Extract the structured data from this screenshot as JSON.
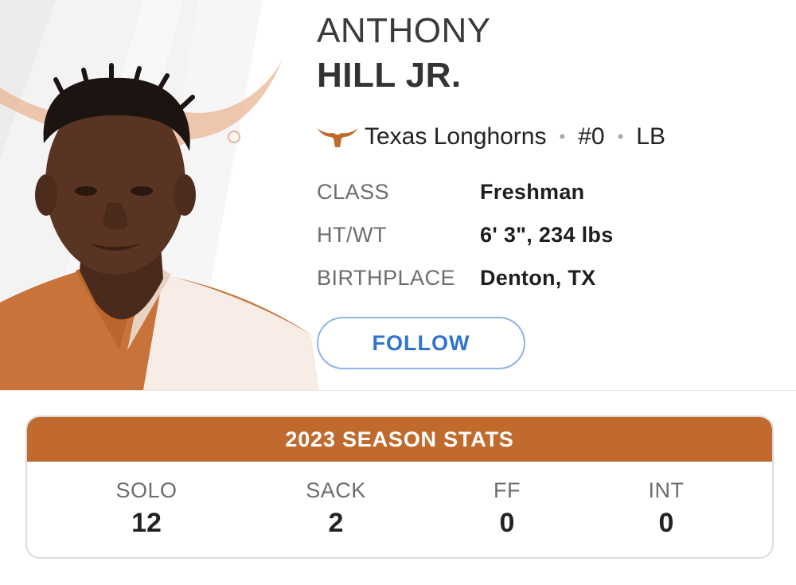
{
  "player": {
    "first_name": "ANTHONY",
    "last_name": "HILL JR.",
    "team": "Texas Longhorns",
    "number": "#0",
    "position": "LB",
    "separator": "•"
  },
  "details": [
    {
      "label": "CLASS",
      "value": "Freshman"
    },
    {
      "label": "HT/WT",
      "value": "6' 3\", 234 lbs"
    },
    {
      "label": "BIRTHPLACE",
      "value": "Denton, TX"
    }
  ],
  "actions": {
    "follow_label": "FOLLOW"
  },
  "stats": {
    "title": "2023 SEASON STATS",
    "items": [
      {
        "label": "SOLO",
        "value": "12"
      },
      {
        "label": "SACK",
        "value": "2"
      },
      {
        "label": "FF",
        "value": "0"
      },
      {
        "label": "INT",
        "value": "0"
      }
    ]
  },
  "icons": {
    "team_logo": "longhorn-logo-icon",
    "photo": "player-headshot"
  },
  "colors": {
    "team_accent": "#c06a2e",
    "follow_border": "#8fb4e6",
    "follow_text": "#2f74d0"
  }
}
